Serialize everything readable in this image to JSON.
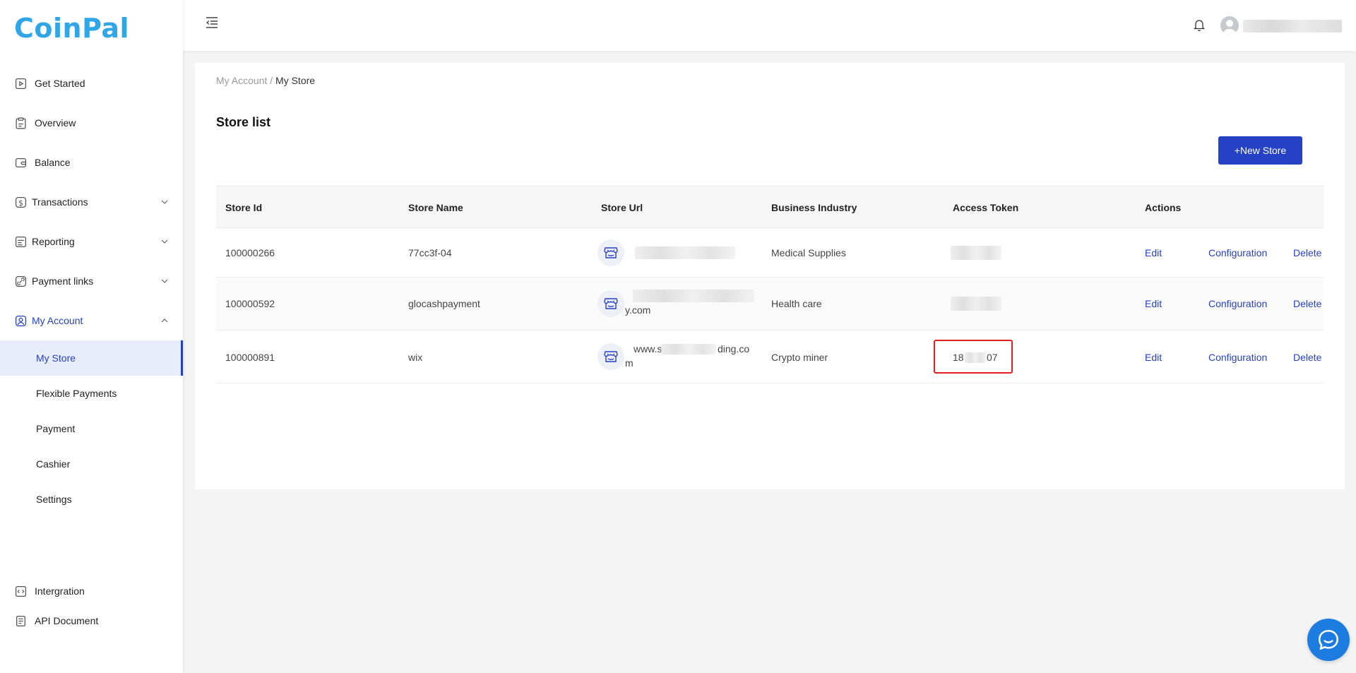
{
  "app": {
    "logo_text": "CoinPal",
    "brand_color": "#2fa6e8",
    "accent_color": "#2541c5"
  },
  "sidebar": {
    "items": [
      {
        "label": "Get Started",
        "icon": "play-doc-icon"
      },
      {
        "label": "Overview",
        "icon": "clipboard-icon"
      },
      {
        "label": "Balance",
        "icon": "wallet-icon"
      },
      {
        "label": "Transactions",
        "icon": "dollar-circle-icon",
        "expandable": true
      },
      {
        "label": "Reporting",
        "icon": "report-icon",
        "expandable": true
      },
      {
        "label": "Payment links",
        "icon": "link-icon",
        "expandable": true
      },
      {
        "label": "My Account",
        "icon": "user-icon",
        "expandable": true,
        "expanded": true
      }
    ],
    "sub_items": [
      {
        "label": "My Store",
        "active": true
      },
      {
        "label": "Flexible Payments"
      },
      {
        "label": "Payment"
      },
      {
        "label": "Cashier"
      },
      {
        "label": "Settings"
      }
    ],
    "bottom_items": [
      {
        "label": "Intergration",
        "icon": "code-icon"
      },
      {
        "label": "API Document",
        "icon": "document-icon"
      }
    ]
  },
  "header": {
    "menu_icon": "menu-collapse-icon",
    "bell_icon": "bell-icon",
    "user_name": ""
  },
  "breadcrumb": {
    "parent": "My Account",
    "separator": " / ",
    "current": "My Store"
  },
  "page": {
    "title": "Store list",
    "new_button": "+New Store"
  },
  "table": {
    "headers": [
      "Store Id",
      "Store Name",
      "Store Url",
      "Business Industry",
      "Access Token",
      "Actions"
    ],
    "rows": [
      {
        "id": "100000266",
        "name": "77cc3f-04",
        "url_line1": "",
        "url_line2": "",
        "industry": "Medical Supplies",
        "token": ""
      },
      {
        "id": "100000592",
        "name": "glocashpayment",
        "url_line1": "",
        "url_line2": "y.com",
        "industry": "Health care",
        "token": ""
      },
      {
        "id": "100000891",
        "name": "wix",
        "url_line1": "www.s",
        "url_line1_end": "ding.co",
        "url_line2": "m",
        "industry": "Crypto miner",
        "token": "18",
        "token_end": "07",
        "highlighted": true
      }
    ],
    "actions": {
      "edit": "Edit",
      "config": "Configuration",
      "delete": "Delete"
    }
  },
  "chat": {
    "icon": "chat-bubble-icon",
    "color": "#1c7ce0"
  }
}
